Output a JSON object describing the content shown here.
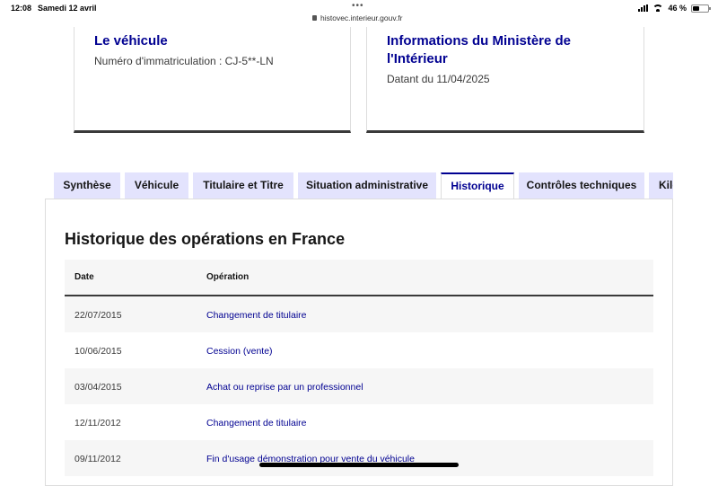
{
  "status_bar": {
    "time": "12:08",
    "date": "Samedi 12 avril",
    "url": "histovec.interieur.gouv.fr",
    "battery": "46 %",
    "battery_level": 0.46
  },
  "cards": {
    "vehicle": {
      "title": "Le véhicule",
      "text": "Numéro d'immatriculation : CJ-5**-LN"
    },
    "ministry": {
      "title": "Informations du Ministère de l'Intérieur",
      "text": "Datant du 11/04/2025"
    }
  },
  "tabs": [
    {
      "label": "Synthèse",
      "active": false
    },
    {
      "label": "Véhicule",
      "active": false
    },
    {
      "label": "Titulaire et Titre",
      "active": false
    },
    {
      "label": "Situation administrative",
      "active": false
    },
    {
      "label": "Historique",
      "active": true
    },
    {
      "label": "Contrôles techniques",
      "active": false
    },
    {
      "label": "Kilo",
      "active": false
    }
  ],
  "section": {
    "title": "Historique des opérations en France",
    "columns": [
      "Date",
      "Opération"
    ],
    "rows": [
      {
        "date": "22/07/2015",
        "operation": "Changement de titulaire"
      },
      {
        "date": "10/06/2015",
        "operation": "Cession (vente)"
      },
      {
        "date": "03/04/2015",
        "operation": "Achat ou reprise par un professionnel"
      },
      {
        "date": "12/11/2012",
        "operation": "Changement de titulaire"
      },
      {
        "date": "09/11/2012",
        "operation": "Fin d'usage démonstration pour vente du véhicule"
      }
    ]
  },
  "colors": {
    "primary": "#000091",
    "tab_bg": "#e3e3fd",
    "stripe": "#f6f6f6"
  }
}
